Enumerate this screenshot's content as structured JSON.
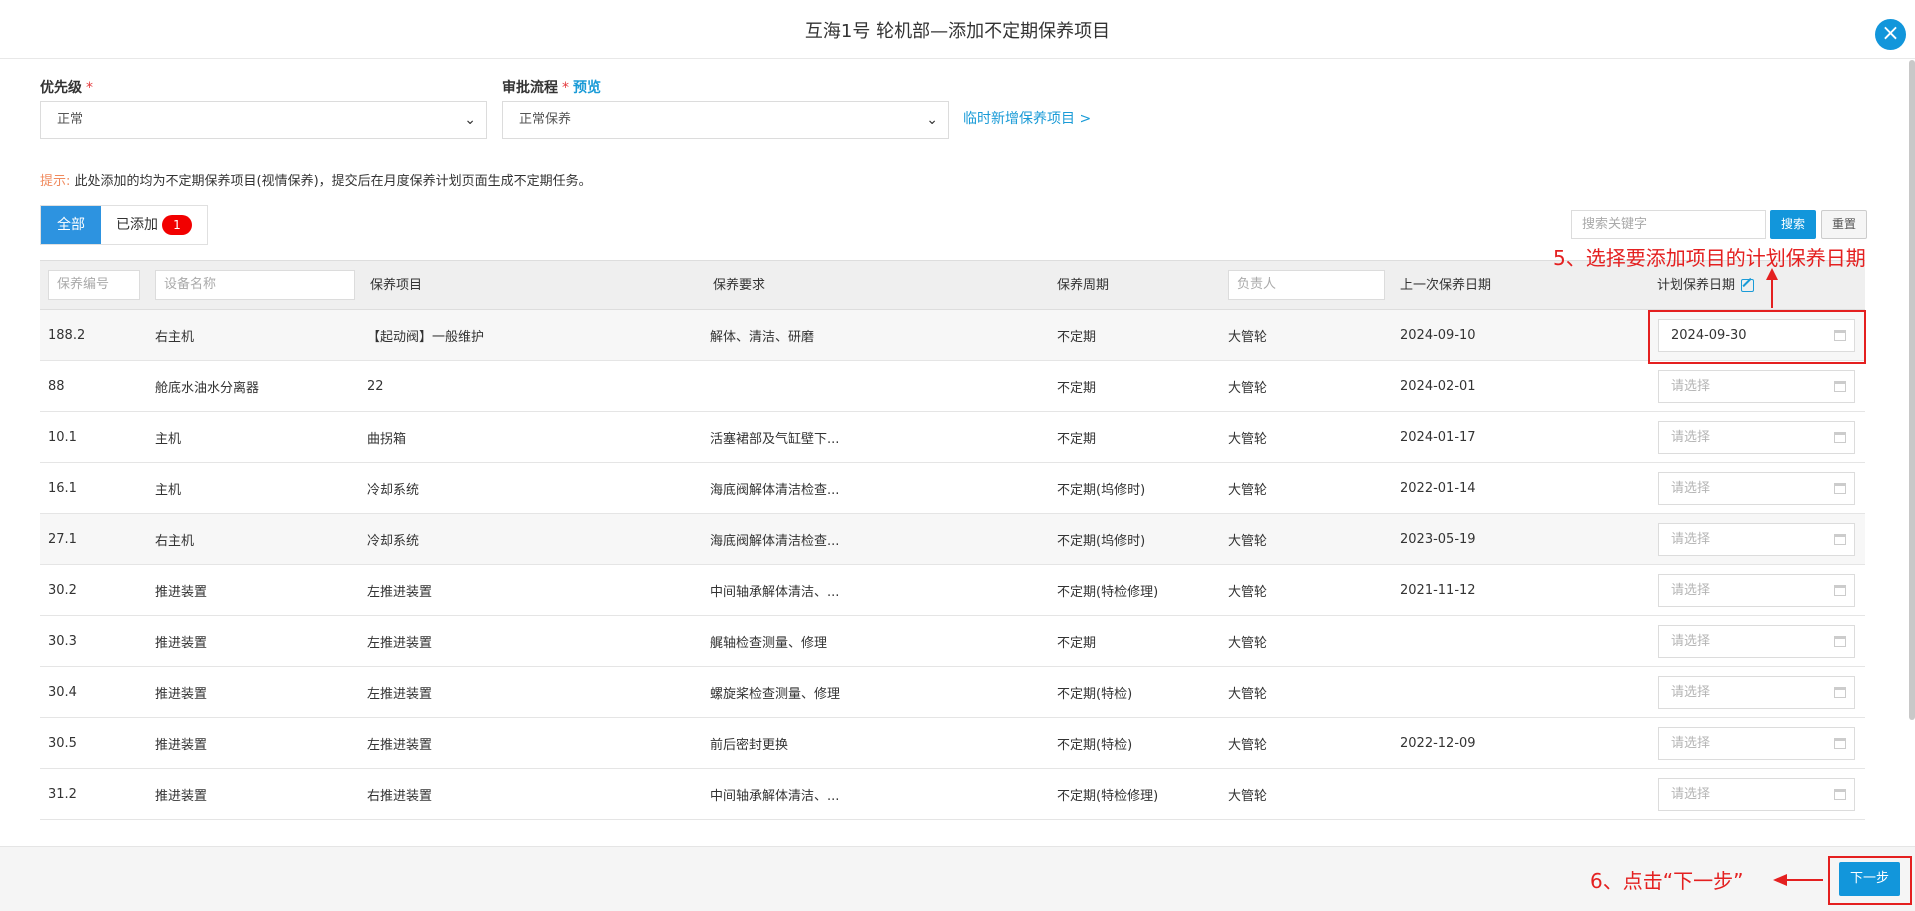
{
  "header": {
    "title": "互海1号 轮机部—添加不定期保养项目",
    "close_icon": "×"
  },
  "form": {
    "priority_label": "优先级",
    "priority_required": "*",
    "priority_value": "正常",
    "flow_label": "审批流程",
    "flow_required": "*",
    "flow_preview": "预览",
    "flow_value": "正常保养",
    "temp_add_link": "临时新增保养项目 >"
  },
  "tip": {
    "label": "提示:",
    "text": "此处添加的均为不定期保养项目(视情保养)，提交后在月度保养计划页面生成不定期任务。"
  },
  "tabs": [
    {
      "label": "全部",
      "active": true
    },
    {
      "label": "已添加",
      "badge": "1",
      "active": false
    }
  ],
  "search": {
    "placeholder": "搜索关键字",
    "search_label": "搜索",
    "reset_label": "重置"
  },
  "table": {
    "headers": {
      "code_placeholder": "保养编号",
      "device_placeholder": "设备名称",
      "item": "保养项目",
      "requirement": "保养要求",
      "cycle": "保养周期",
      "owner_placeholder": "负责人",
      "last_date": "上一次保养日期",
      "plan_date": "计划保养日期"
    },
    "date_placeholder": "请选择",
    "rows": [
      {
        "code": "188.2",
        "device": "右主机",
        "item": "【起动阀】一般维护",
        "requirement": "解体、清洁、研磨",
        "cycle": "不定期",
        "owner": "大管轮",
        "last_date": "2024-09-10",
        "plan_date": "2024-09-30"
      },
      {
        "code": "88",
        "device": "舱底水油水分离器",
        "item": "22",
        "requirement": "",
        "cycle": "不定期",
        "owner": "大管轮",
        "last_date": "2024-02-01",
        "plan_date": ""
      },
      {
        "code": "10.1",
        "device": "主机",
        "item": "曲拐箱",
        "requirement": "活塞裙部及气缸壁下...",
        "cycle": "不定期",
        "owner": "大管轮",
        "last_date": "2024-01-17",
        "plan_date": ""
      },
      {
        "code": "16.1",
        "device": "主机",
        "item": "冷却系统",
        "requirement": "海底阀解体清洁检查...",
        "cycle": "不定期(坞修时)",
        "owner": "大管轮",
        "last_date": "2022-01-14",
        "plan_date": ""
      },
      {
        "code": "27.1",
        "device": "右主机",
        "item": "冷却系统",
        "requirement": "海底阀解体清洁检查...",
        "cycle": "不定期(坞修时)",
        "owner": "大管轮",
        "last_date": "2023-05-19",
        "plan_date": ""
      },
      {
        "code": "30.2",
        "device": "推进装置",
        "item": "左推进装置",
        "requirement": "中间轴承解体清洁、...",
        "cycle": "不定期(特检修理)",
        "owner": "大管轮",
        "last_date": "2021-11-12",
        "plan_date": ""
      },
      {
        "code": "30.3",
        "device": "推进装置",
        "item": "左推进装置",
        "requirement": "艉轴检查测量、修理",
        "cycle": "不定期",
        "owner": "大管轮",
        "last_date": "",
        "plan_date": ""
      },
      {
        "code": "30.4",
        "device": "推进装置",
        "item": "左推进装置",
        "requirement": "螺旋桨检查测量、修理",
        "cycle": "不定期(特检)",
        "owner": "大管轮",
        "last_date": "",
        "plan_date": ""
      },
      {
        "code": "30.5",
        "device": "推进装置",
        "item": "左推进装置",
        "requirement": "前后密封更换",
        "cycle": "不定期(特检)",
        "owner": "大管轮",
        "last_date": "2022-12-09",
        "plan_date": ""
      },
      {
        "code": "31.2",
        "device": "推进装置",
        "item": "右推进装置",
        "requirement": "中间轴承解体清洁、...",
        "cycle": "不定期(特检修理)",
        "owner": "大管轮",
        "last_date": "",
        "plan_date": ""
      }
    ]
  },
  "footer": {
    "next_label": "下一步"
  },
  "annotations": {
    "step5": "5、选择要添加项目的计划保养日期",
    "step6": "6、点击“下一步”",
    "color": "#e42020"
  },
  "colors": {
    "primary": "#1296db",
    "badge": "#f20000",
    "link": "#1a9bd7"
  }
}
